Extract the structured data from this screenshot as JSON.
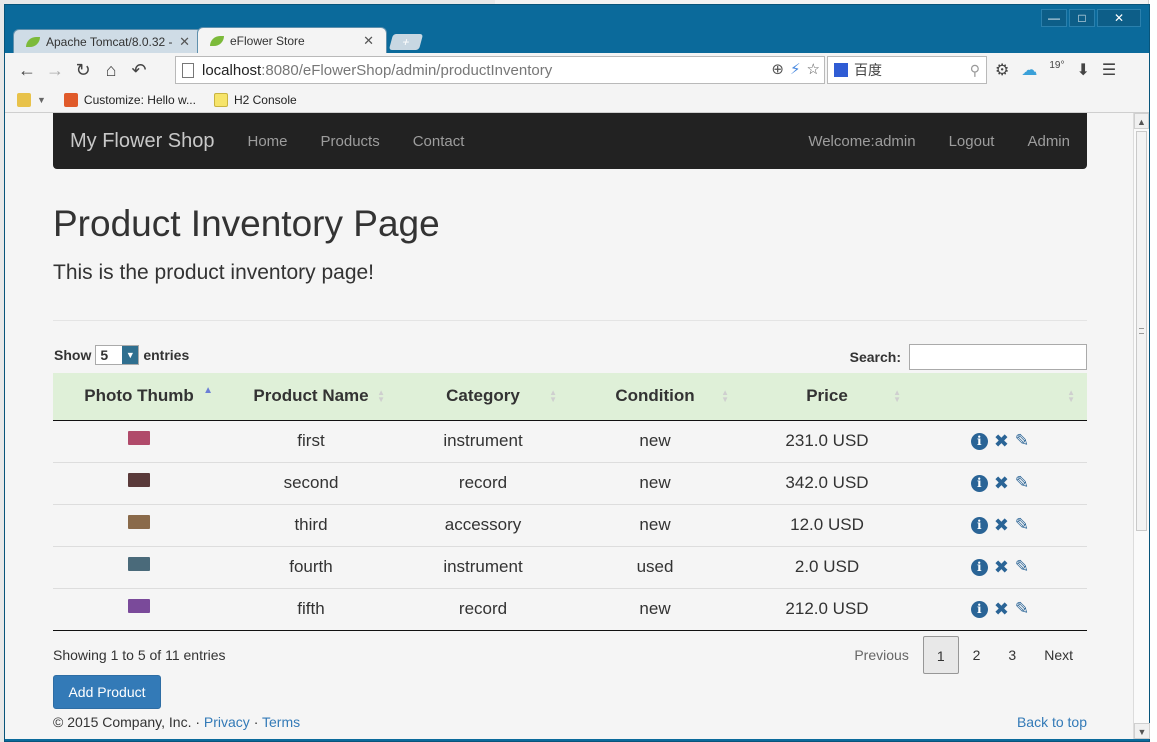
{
  "browser": {
    "tabs": [
      {
        "label": "Apache Tomcat/8.0.32 - E",
        "active": false
      },
      {
        "label": "eFlower Store",
        "active": true
      }
    ],
    "url_host": "localhost",
    "url_rest": ":8080/eFlowerShop/admin/productInventory",
    "search_engine": "百度",
    "bookmarks": [
      "Customize: Hello w...",
      "H2 Console"
    ],
    "weather_temp": "19°"
  },
  "navbar": {
    "brand": "My Flower Shop",
    "links": [
      "Home",
      "Products",
      "Contact"
    ],
    "welcome": "Welcome:admin",
    "logout": "Logout",
    "admin": "Admin"
  },
  "page": {
    "title": "Product Inventory Page",
    "lead": "This is the product inventory page!"
  },
  "datatable": {
    "show_label": "Show",
    "entries_label": "entries",
    "page_length": "5",
    "search_label": "Search:",
    "columns": [
      "Photo Thumb",
      "Product Name",
      "Category",
      "Condition",
      "Price",
      ""
    ],
    "rows": [
      {
        "name": "first",
        "category": "instrument",
        "condition": "new",
        "price": "231.0 USD",
        "thumb_color": "#b04a6a"
      },
      {
        "name": "second",
        "category": "record",
        "condition": "new",
        "price": "342.0 USD",
        "thumb_color": "#5a3a3a"
      },
      {
        "name": "third",
        "category": "accessory",
        "condition": "new",
        "price": "12.0 USD",
        "thumb_color": "#8a6a4a"
      },
      {
        "name": "fourth",
        "category": "instrument",
        "condition": "used",
        "price": "2.0 USD",
        "thumb_color": "#4a6a7a"
      },
      {
        "name": "fifth",
        "category": "record",
        "condition": "new",
        "price": "212.0 USD",
        "thumb_color": "#7a4a9a"
      }
    ],
    "info": "Showing 1 to 5 of 11 entries",
    "pagination": {
      "previous": "Previous",
      "pages": [
        "1",
        "2",
        "3"
      ],
      "next": "Next",
      "current": "1"
    }
  },
  "add_button": "Add Product",
  "footer": {
    "copyright": "© 2015 Company, Inc. ·",
    "privacy": "Privacy",
    "sep": "·",
    "terms": "Terms",
    "back_to_top": "Back to top"
  },
  "colors": {
    "navbar_bg": "#222222",
    "table_header_bg": "#dff0d8",
    "primary": "#337ab7",
    "action_icon": "#2a6496"
  },
  "icons": {
    "row_actions": [
      "info-icon",
      "remove-icon",
      "edit-icon"
    ]
  }
}
